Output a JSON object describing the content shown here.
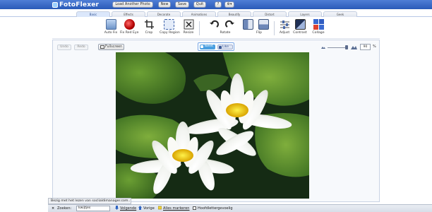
{
  "app": {
    "name": "FotoFlexer",
    "buttons": {
      "load": "Load Another Photo",
      "new": "New",
      "save": "Save",
      "quit": "Quit",
      "help": "?",
      "settings": "⚙▾"
    }
  },
  "tabs": [
    "Basic",
    "Effects",
    "Decorate",
    "Animations",
    "Beautify",
    "Distort",
    "Layers",
    "Geek"
  ],
  "active_tab": "Basic",
  "tools": [
    {
      "label": "Auto Fix",
      "icon": "auto-fix-icon"
    },
    {
      "label": "Fix Red Eye",
      "icon": "red-eye-icon"
    },
    {
      "label": "Crop",
      "icon": "crop-icon"
    },
    {
      "label": "Copy Region",
      "icon": "copy-region-icon"
    },
    {
      "label": "Resize",
      "icon": "resize-icon"
    },
    {
      "label": "Rotate",
      "icon": "rotate-icon"
    },
    {
      "label": "Flip",
      "icon": "flip-icon"
    },
    {
      "label": "Adjust",
      "icon": "adjust-icon"
    },
    {
      "label": "Contrast",
      "icon": "contrast-icon"
    },
    {
      "label": "Collage",
      "icon": "collage-icon"
    }
  ],
  "canvas": {
    "undo": "Undo",
    "redo": "Redo",
    "fullscreen": "Fullscreen",
    "tweet": "Tweet",
    "like": "Like",
    "zoom_value": "90",
    "zoom_unit": "%"
  },
  "status": "Bezig met het lezen van soclialdimanager.com...",
  "findbar": {
    "close": "×",
    "label": "Zoeken:",
    "query": "kwijtjes",
    "next": "Volgende",
    "prev": "Vorige",
    "highlight_all": "Alles markeren",
    "match_case": "Hoofdlettergevoelig"
  },
  "colors": {
    "topbar": "#2a5ab8",
    "accent": "#4a9fe0"
  }
}
